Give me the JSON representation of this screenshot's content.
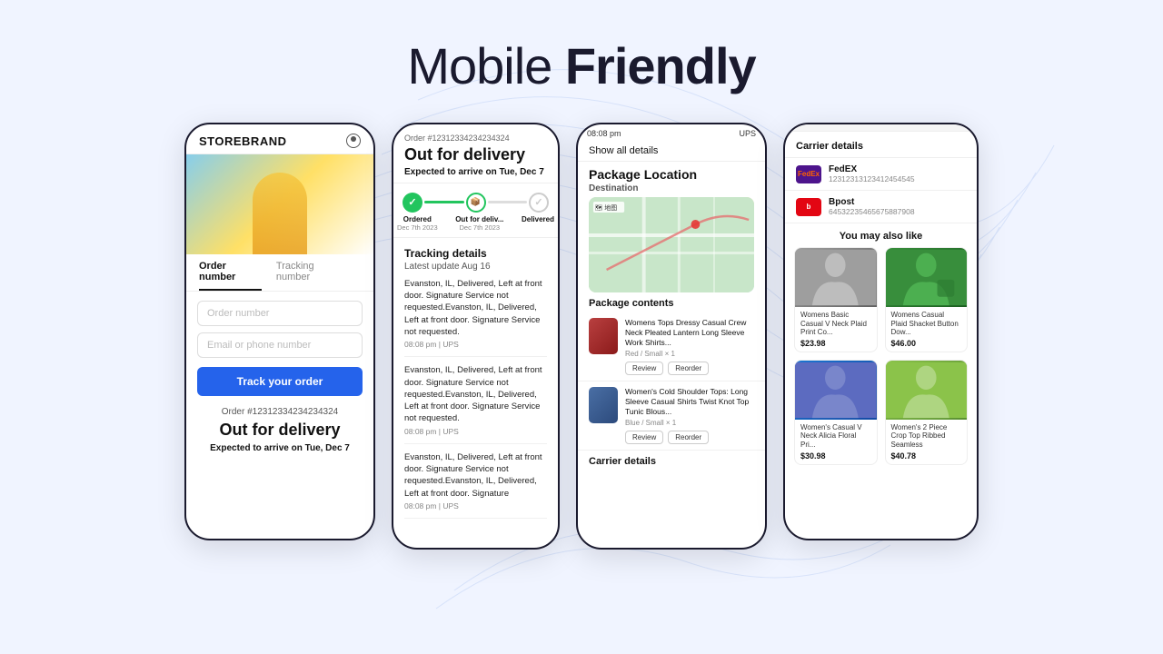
{
  "hero": {
    "title_light": "Mobile ",
    "title_bold": "Friendly"
  },
  "phone1": {
    "brand": "STOREBRAND",
    "tab1": "Order number",
    "tab2": "Tracking number",
    "input_order": "Order number",
    "input_email": "Email or phone number",
    "track_btn": "Track your order",
    "order_num": "Order #12312334234234324",
    "delivery_status": "Out for delivery",
    "expected_prefix": "Expected to arrive on  ",
    "expected_date": "Tue, Dec 7"
  },
  "phone2": {
    "order_label": "Order #12312334234234324",
    "delivery_status": "Out for delivery",
    "expected_prefix": "Expected to arrive on ",
    "expected_date": "Tue, Dec 7",
    "steps": [
      {
        "label": "Ordered",
        "date": "Dec 7th 2023",
        "state": "done"
      },
      {
        "label": "Out for deliv...",
        "date": "Dec 7th 2023",
        "state": "active"
      },
      {
        "label": "Delivered",
        "date": "",
        "state": "pending"
      }
    ],
    "tracking_title": "Tracking details",
    "latest_update": "Latest update Aug 16",
    "events": [
      {
        "text": "Evanston, IL, Delivered, Left at front door. Signature Service not requested.Evanston, IL, Delivered, Left at front door. Signature Service not requested.",
        "meta": "08:08 pm  |  UPS"
      },
      {
        "text": "Evanston, IL, Delivered, Left at front door. Signature Service not requested.Evanston, IL, Delivered, Left at front door. Signature Service not requested.",
        "meta": "08:08 pm  |  UPS"
      },
      {
        "text": "Evanston, IL, Delivered, Left at front door. Signature Service not requested.Evanston, IL, Delivered, Left at front door. Signature",
        "meta": "08:08 pm  |  UPS"
      }
    ]
  },
  "phone3": {
    "statusbar_time": "08:08 pm",
    "statusbar_carrier": "UPS",
    "show_all": "Show all details",
    "pkg_location": "Package Location",
    "destination": "Destination",
    "pkg_contents": "Package contents",
    "items": [
      {
        "name": "Womens Tops Dressy Casual Crew Neck Pleated Lantern Long Sleeve Work Shirts...",
        "variant": "Red / Small  × 1",
        "color": "red"
      },
      {
        "name": "Women's Cold Shoulder Tops: Long Sleeve Casual Shirts Twist Knot Top Tunic Blous...",
        "variant": "Blue / Small  × 1",
        "color": "blue"
      }
    ],
    "carrier_label": "Carrier details"
  },
  "phone4": {
    "carrier_title": "Carrier details",
    "carriers": [
      {
        "name": "FedEX",
        "num": "12312313123412454545",
        "logo_type": "fedex"
      },
      {
        "name": "Bpost",
        "num": "64532235465675887908",
        "logo_type": "bpost"
      }
    ],
    "recommend_title": "You may also like",
    "products": [
      {
        "name": "Womens Basic Casual V Neck Plaid Print Co...",
        "price": "$23.98",
        "color": "grey"
      },
      {
        "name": "Womens Casual Plaid Shacket Button Dow...",
        "price": "$46.00",
        "color": "darkgreen"
      },
      {
        "name": "Women's Casual V Neck Alicia Floral Pri...",
        "price": "$30.98",
        "color": "blue2"
      },
      {
        "name": "Women's 2 Piece Crop Top Ribbed Seamless",
        "price": "$40.78",
        "color": "green2"
      }
    ]
  }
}
